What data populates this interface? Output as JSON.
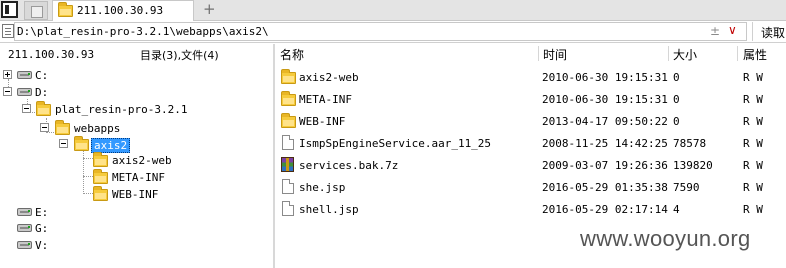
{
  "tabbar": {
    "active_tab_label": "211.100.30.93",
    "add_tab_symbol": "+"
  },
  "address": {
    "path": "D:\\plat_resin-pro-3.2.1\\webapps\\axis2\\",
    "plus_minus": "±",
    "dropdown_symbol": "∨",
    "read_button": "读取"
  },
  "left_pane": {
    "host": "211.100.30.93",
    "summary": "目录(3),文件(4)"
  },
  "tree": {
    "drive_c": "C:",
    "drive_d": "D:",
    "plat_resin": "plat_resin-pro-3.2.1",
    "webapps": "webapps",
    "axis2": "axis2",
    "axis2_web": "axis2-web",
    "meta_inf": "META-INF",
    "web_inf": "WEB-INF",
    "drive_e": "E:",
    "drive_g": "G:",
    "drive_v": "V:"
  },
  "list": {
    "columns": {
      "name": "名称",
      "time": "时间",
      "size": "大小",
      "attr": "属性"
    },
    "rows": [
      {
        "icon": "folder-icon",
        "name": "axis2-web",
        "time": "2010-06-30 19:15:31",
        "size": "0",
        "attr": "R W"
      },
      {
        "icon": "folder-icon",
        "name": "META-INF",
        "time": "2010-06-30 19:15:31",
        "size": "0",
        "attr": "R W"
      },
      {
        "icon": "folder-icon",
        "name": "WEB-INF",
        "time": "2013-04-17 09:50:22",
        "size": "0",
        "attr": "R W"
      },
      {
        "icon": "file-icon",
        "name": "IsmpSpEngineService.aar_11_25",
        "time": "2008-11-25 14:42:25",
        "size": "78578",
        "attr": "R W"
      },
      {
        "icon": "archive-icon",
        "name": "services.bak.7z",
        "time": "2009-03-07 19:26:36",
        "size": "139820",
        "attr": "R W"
      },
      {
        "icon": "file-icon",
        "name": "she.jsp",
        "time": "2016-05-29 01:35:38",
        "size": "7590",
        "attr": "R W"
      },
      {
        "icon": "file-icon",
        "name": "shell.jsp",
        "time": "2016-05-29 02:17:14",
        "size": "4",
        "attr": "R W"
      }
    ]
  },
  "watermark": "www.wooyun.org"
}
